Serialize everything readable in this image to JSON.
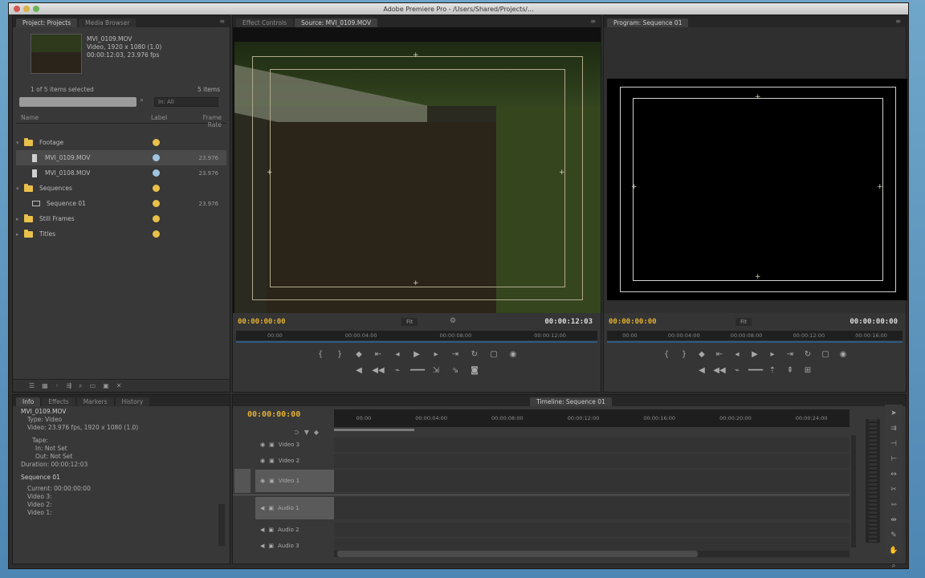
{
  "window": {
    "title": "Adobe Premiere Pro - /Users/Shared/Projects/..."
  },
  "project": {
    "tabs": [
      "Project: Projects",
      "Media Browser"
    ],
    "clip_name": "MVI_0109.MOV",
    "clip_details": [
      "Video, 1920 x 1080 (1.0)",
      "00:00:12:03, 23.976 fps"
    ],
    "item_count": "1 of 5 items selected",
    "items_label": "5 items",
    "in_label": "In: All",
    "columns": [
      "Name",
      "Label",
      "Frame Rate"
    ],
    "tree": [
      {
        "name": "Footage",
        "type": "folder",
        "label": "yellow",
        "rate": ""
      },
      {
        "name": "MVI_0109.MOV",
        "type": "clip",
        "label": "blue",
        "rate": "23.976",
        "selected": true
      },
      {
        "name": "MVI_0108.MOV",
        "type": "clip",
        "label": "blue",
        "rate": "23.976"
      },
      {
        "name": "Sequences",
        "type": "folder",
        "label": "yellow",
        "rate": ""
      },
      {
        "name": "Sequence 01",
        "type": "sequence",
        "label": "yellow",
        "rate": "23.976"
      },
      {
        "name": "Still Frames",
        "type": "folder",
        "label": "yellow",
        "rate": ""
      },
      {
        "name": "Titles",
        "type": "folder",
        "label": "yellow",
        "rate": ""
      }
    ]
  },
  "source": {
    "tabs": [
      "Effect Controls",
      "Source: MVI_0109.MOV"
    ],
    "timecode_in": "00:00:00:00",
    "fit": "Fit",
    "timecode_out": "00:00:12:03",
    "ruler": [
      "00:00",
      "00:00:04:00",
      "00:00:08:00",
      "00:00:12:00"
    ]
  },
  "program": {
    "tabs": [
      "Program: Sequence 01"
    ],
    "timecode_in": "00:00:00:00",
    "fit": "Fit",
    "timecode_out": "00:00:00:00",
    "ruler": [
      "00:00",
      "00:00:04:00",
      "00:00:08:00",
      "00:00:12:00",
      "00:00:16:00"
    ]
  },
  "info": {
    "tabs": [
      "Info",
      "Effects",
      "Markers",
      "History"
    ],
    "lines": [
      "MVI_0109.MOV",
      "Type: Video",
      "Video: 23.976 fps, 1920 x 1080 (1.0)",
      "",
      "Tape:",
      "In: Not Set",
      "Out: Not Set",
      "Duration: 00:00:12:03",
      "",
      "Sequence 01",
      "",
      "Current: 00:00:00:00",
      "Video 3:",
      "Video 2:",
      "Video 1:"
    ]
  },
  "timeline": {
    "tabs": [
      "Timeline: Sequence 01"
    ],
    "timecode": "00:00:00:00",
    "ruler": [
      "00:00",
      "00:00:04:00",
      "00:00:08:00",
      "00:00:12:00",
      "00:00:16:00",
      "00:00:20:00",
      "00:00:24:00"
    ],
    "tracks": [
      {
        "name": "Video 3",
        "highlight": false
      },
      {
        "name": "Video 2",
        "highlight": false
      },
      {
        "name": "Video 1",
        "highlight": true
      },
      {
        "name": "Audio 1",
        "highlight": true
      },
      {
        "name": "Audio 2",
        "highlight": false
      },
      {
        "name": "Audio 3",
        "highlight": false
      }
    ]
  }
}
